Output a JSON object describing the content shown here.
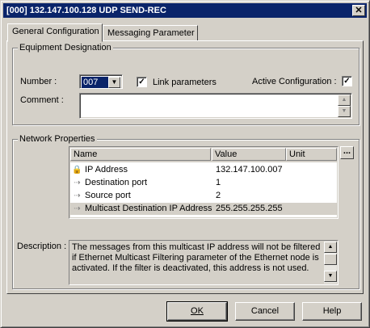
{
  "window": {
    "title": "[000]  132.147.100.128   UDP SEND-REC",
    "close_label": "✕"
  },
  "tabs": [
    {
      "label": "General Configuration",
      "active": true
    },
    {
      "label": "Messaging Parameter",
      "active": false
    }
  ],
  "equipment": {
    "group_label": "Equipment Designation",
    "number_label": "Number :",
    "number_value": "007",
    "link_label": "Link parameters",
    "link_checked": true,
    "active_label": "Active Configuration :",
    "active_checked": true,
    "comment_label": "Comment :",
    "comment_value": ""
  },
  "network": {
    "group_label": "Network Properties",
    "columns": [
      "Name",
      "Value",
      "Unit"
    ],
    "ellipsis_label": "...",
    "rows": [
      {
        "icon": "lock-icon",
        "name": "IP Address",
        "value": "132.147.100.007",
        "unit": "",
        "selected": false
      },
      {
        "icon": "arrow-icon",
        "name": "Destination port",
        "value": "1",
        "unit": "",
        "selected": false
      },
      {
        "icon": "arrow-icon",
        "name": "Source port",
        "value": "2",
        "unit": "",
        "selected": false
      },
      {
        "icon": "arrow-icon",
        "name": "Multicast Destination IP Address",
        "value": "255.255.255.255",
        "unit": "",
        "selected": true
      }
    ],
    "description_label": "Description :",
    "description_text": "The messages from this multicast IP address will not be filtered if Ethernet Multicast Filtering parameter of the Ethernet node is activated. If the filter is deactivated, this address is not used."
  },
  "buttons": {
    "ok": "OK",
    "cancel": "Cancel",
    "help": "Help"
  }
}
